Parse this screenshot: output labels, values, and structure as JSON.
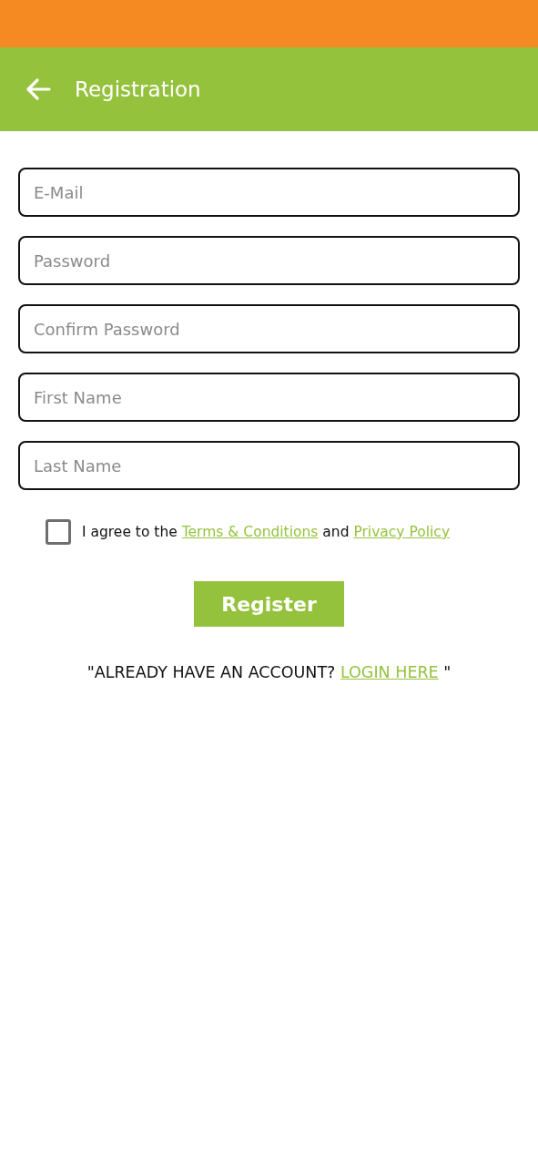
{
  "header": {
    "title": "Registration"
  },
  "fields": [
    {
      "placeholder": "E-Mail"
    },
    {
      "placeholder": "Password"
    },
    {
      "placeholder": "Confirm Password"
    },
    {
      "placeholder": "First Name"
    },
    {
      "placeholder": "Last Name"
    }
  ],
  "agreement": {
    "checked": false,
    "text_before": "I agree to the",
    "terms_link": "Terms & Conditions",
    "middle": "and",
    "privacy_link": "Privacy Policy"
  },
  "register_button": "Register",
  "login_prompt": {
    "before": "\"ALREADY HAVE AN ACCOUNT?",
    "link": "LOGIN HERE",
    "after": "\""
  }
}
